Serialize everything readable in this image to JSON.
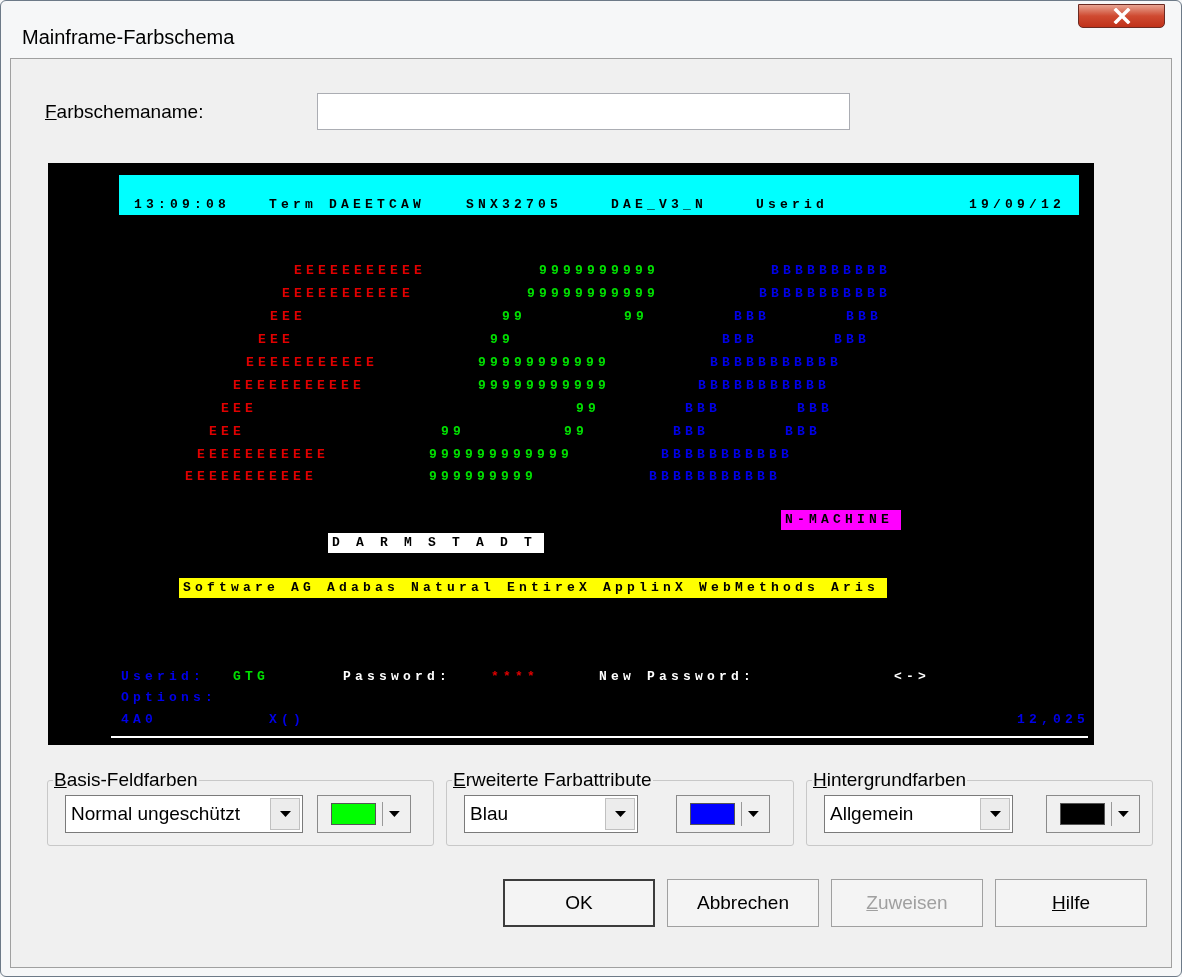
{
  "window": {
    "title": "Mainframe-Farbschema"
  },
  "name_field": {
    "label": "Farbschemaname:",
    "accelerator": true
  },
  "terminal": {
    "header": [
      "13:09:08",
      "Term DAEETCAW",
      "SNX32705",
      "DAE_V3_N",
      "Userid",
      "19/09/12"
    ],
    "logo_rows": [
      [
        {
          "text": "EEEEEEEEEEE",
          "color": "#e00000"
        },
        {
          "text": "9999999999",
          "color": "#00e000"
        },
        {
          "text": "BBBBBBBBBB",
          "color": "#0000e8"
        }
      ],
      [
        {
          "text": "EEEEEEEEEEE",
          "color": "#e00000"
        },
        {
          "text": "99999999999",
          "color": "#00e000"
        },
        {
          "text": "BBBBBBBBBBB",
          "color": "#0000e8"
        }
      ],
      [
        {
          "text": "EEE",
          "color": "#e00000"
        },
        {
          "text": "99",
          "color": "#00e000"
        },
        {
          "text": "99",
          "color": "#00e000"
        },
        {
          "text": "BBB",
          "color": "#0000e8"
        },
        {
          "text": "BBB",
          "color": "#0000e8"
        }
      ],
      [
        {
          "text": "EEE",
          "color": "#e00000"
        },
        {
          "text": "99",
          "color": "#00e000"
        },
        {
          "text": "BBB",
          "color": "#0000e8"
        },
        {
          "text": "BBB",
          "color": "#0000e8"
        }
      ],
      [
        {
          "text": "EEEEEEEEEEE",
          "color": "#e00000"
        },
        {
          "text": "99999999999",
          "color": "#00e000"
        },
        {
          "text": "BBBBBBBBBBB",
          "color": "#0000e8"
        }
      ],
      [
        {
          "text": "EEEEEEEEEEE",
          "color": "#e00000"
        },
        {
          "text": "99999999999",
          "color": "#00e000"
        },
        {
          "text": "BBBBBBBBBBB",
          "color": "#0000e8"
        }
      ],
      [
        {
          "text": "EEE",
          "color": "#e00000"
        },
        {
          "text": "99",
          "color": "#00e000"
        },
        {
          "text": "BBB",
          "color": "#0000e8"
        },
        {
          "text": "BBB",
          "color": "#0000e8"
        }
      ],
      [
        {
          "text": "EEE",
          "color": "#e00000"
        },
        {
          "text": "99",
          "color": "#00e000"
        },
        {
          "text": "99",
          "color": "#00e000"
        },
        {
          "text": "BBB",
          "color": "#0000e8"
        },
        {
          "text": "BBB",
          "color": "#0000e8"
        }
      ],
      [
        {
          "text": "EEEEEEEEEEE",
          "color": "#e00000"
        },
        {
          "text": "999999999999",
          "color": "#00e000"
        },
        {
          "text": "BBBBBBBBBBB",
          "color": "#0000e8"
        }
      ],
      [
        {
          "text": "EEEEEEEEEEE",
          "color": "#e00000"
        },
        {
          "text": "999999999",
          "color": "#00e000"
        },
        {
          "text": "BBBBBBBBBBB",
          "color": "#0000e8"
        }
      ]
    ],
    "banners": [
      {
        "text": "N-MACHINE",
        "color": "#ff00ff"
      },
      {
        "text": "D A R M S T A D T",
        "color": "#ffffff"
      },
      {
        "text": "Software AG Adabas Natural EntireX ApplinX WebMethods Aris",
        "color": "#ffff00"
      }
    ],
    "fields": [
      {
        "text": "Userid:",
        "color": "#0000e8"
      },
      {
        "text": "GTG",
        "color": "#00e000"
      },
      {
        "text": "Password:",
        "color": "#ffffff"
      },
      {
        "text": "****",
        "color": "#e00000"
      },
      {
        "text": "New Password:",
        "color": "#ffffff"
      },
      {
        "text": "<->",
        "color": "#ffffff"
      },
      {
        "text": "Options:",
        "color": "#0000e8"
      },
      {
        "text": "4A0",
        "color": "#0000e8"
      },
      {
        "text": "X()",
        "color": "#0000e8"
      },
      {
        "text": "12,025",
        "color": "#0000e8"
      }
    ]
  },
  "groups": [
    {
      "label": "Basis-Feldfarben",
      "accelerator": true,
      "value": "Normal ungeschützt",
      "color": "#00ff00"
    },
    {
      "label": "Erweiterte Farbattribute",
      "accelerator": true,
      "value": "Blau",
      "color": "#0000ff"
    },
    {
      "label": "Hintergrundfarben",
      "accelerator": true,
      "value": "Allgemein",
      "color": "#000000"
    }
  ],
  "buttons": [
    {
      "label": "OK",
      "default": true,
      "disabled": false,
      "accelerator": false
    },
    {
      "label": "Abbrechen",
      "default": false,
      "disabled": false,
      "accelerator": false
    },
    {
      "label": "Zuweisen",
      "default": false,
      "disabled": true,
      "accelerator": true
    },
    {
      "label": "Hilfe",
      "default": false,
      "disabled": false,
      "accelerator": true
    }
  ]
}
